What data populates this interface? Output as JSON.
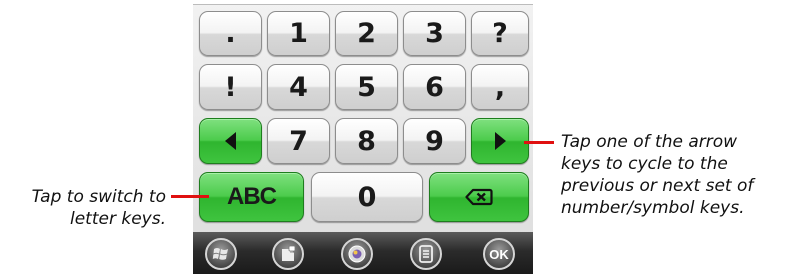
{
  "keypad": {
    "rows": [
      [
        ".",
        "1",
        "2",
        "3",
        "?"
      ],
      [
        "!",
        "4",
        "5",
        "6",
        ","
      ],
      [
        "7",
        "8",
        "9"
      ]
    ],
    "last_row_letter_key": "ABC",
    "last_row_zero_key": "0",
    "icons": {
      "prev": "left-arrow-icon",
      "next": "right-arrow-icon",
      "backspace": "backspace-icon"
    },
    "green_color": "#3fc43f"
  },
  "taskbar": {
    "buttons": [
      "start-icon",
      "notes-icon",
      "media-icon",
      "keyboard-icon"
    ],
    "ok_label": "OK"
  },
  "callouts": {
    "left_line1": "Tap to switch to",
    "left_line2": "letter keys.",
    "right_line1": "Tap one of the arrow",
    "right_line2": "keys to cycle to the",
    "right_line3": "previous or next set of",
    "right_line4": "number/symbol keys.",
    "line_color": "#e01010"
  }
}
